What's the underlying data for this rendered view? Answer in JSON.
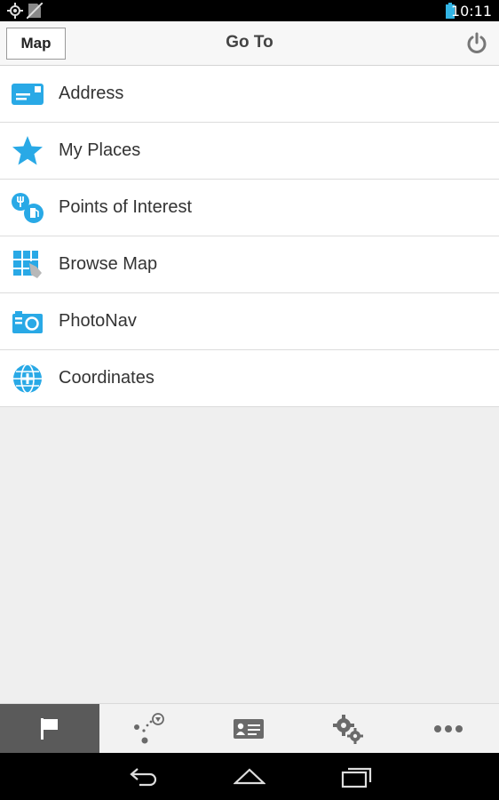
{
  "status_bar": {
    "time": "10:11",
    "left_icons": [
      "gps-icon",
      "no-sim-icon"
    ],
    "right_icons": [
      "battery-icon"
    ]
  },
  "header": {
    "map_button_label": "Map",
    "title": "Go To",
    "power_icon": "power-icon"
  },
  "menu": {
    "items": [
      {
        "label": "Address",
        "icon": "address-card-icon"
      },
      {
        "label": "My Places",
        "icon": "star-icon"
      },
      {
        "label": "Points of Interest",
        "icon": "poi-icon"
      },
      {
        "label": "Browse Map",
        "icon": "browse-map-icon"
      },
      {
        "label": "PhotoNav",
        "icon": "camera-icon"
      },
      {
        "label": "Coordinates",
        "icon": "globe-icon"
      }
    ]
  },
  "tab_bar": {
    "tabs": [
      {
        "icon": "flag-icon",
        "active": true
      },
      {
        "icon": "route-icon",
        "active": false
      },
      {
        "icon": "contact-card-icon",
        "active": false
      },
      {
        "icon": "settings-gears-icon",
        "active": false
      },
      {
        "icon": "more-dots-icon",
        "active": false
      }
    ]
  },
  "nav_bar": {
    "buttons": [
      "back-icon",
      "home-icon",
      "recent-apps-icon"
    ]
  },
  "colors": {
    "accent_blue": "#29a9e6",
    "active_tab": "#5a5a5a",
    "background": "#efefef"
  }
}
